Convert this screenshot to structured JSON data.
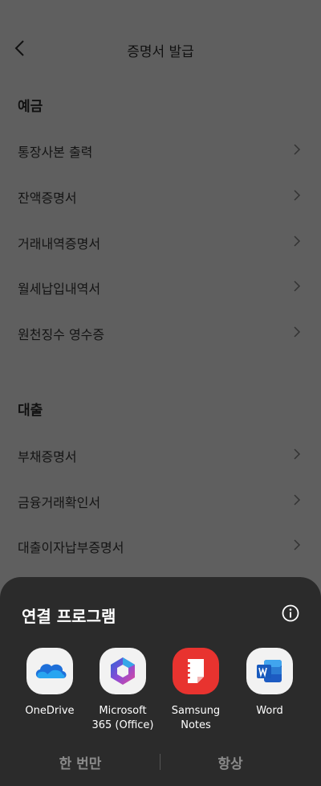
{
  "header": {
    "title": "증명서 발급"
  },
  "sections": [
    {
      "title": "예금",
      "items": [
        "통장사본 출력",
        "잔액증명서",
        "거래내역증명서",
        "월세납입내역서",
        "원천징수 영수증"
      ]
    },
    {
      "title": "대출",
      "items": [
        "부채증명서",
        "금융거래확인서",
        "대출이자납부증명서"
      ]
    }
  ],
  "sheet": {
    "title": "연결 프로그램",
    "info_icon": "info-icon",
    "apps": [
      {
        "label": "OneDrive",
        "icon": "onedrive-icon"
      },
      {
        "label": "Microsoft\n365 (Office)",
        "icon": "microsoft-365-icon"
      },
      {
        "label": "Samsung\nNotes",
        "icon": "samsung-notes-icon"
      },
      {
        "label": "Word",
        "icon": "word-icon"
      }
    ],
    "just_once_label": "한 번만",
    "always_label": "항상"
  },
  "colors": {
    "dim_background": "#5f5f5f",
    "sheet_background": "#2b2b2b",
    "button_text": "#8a8a8a"
  }
}
